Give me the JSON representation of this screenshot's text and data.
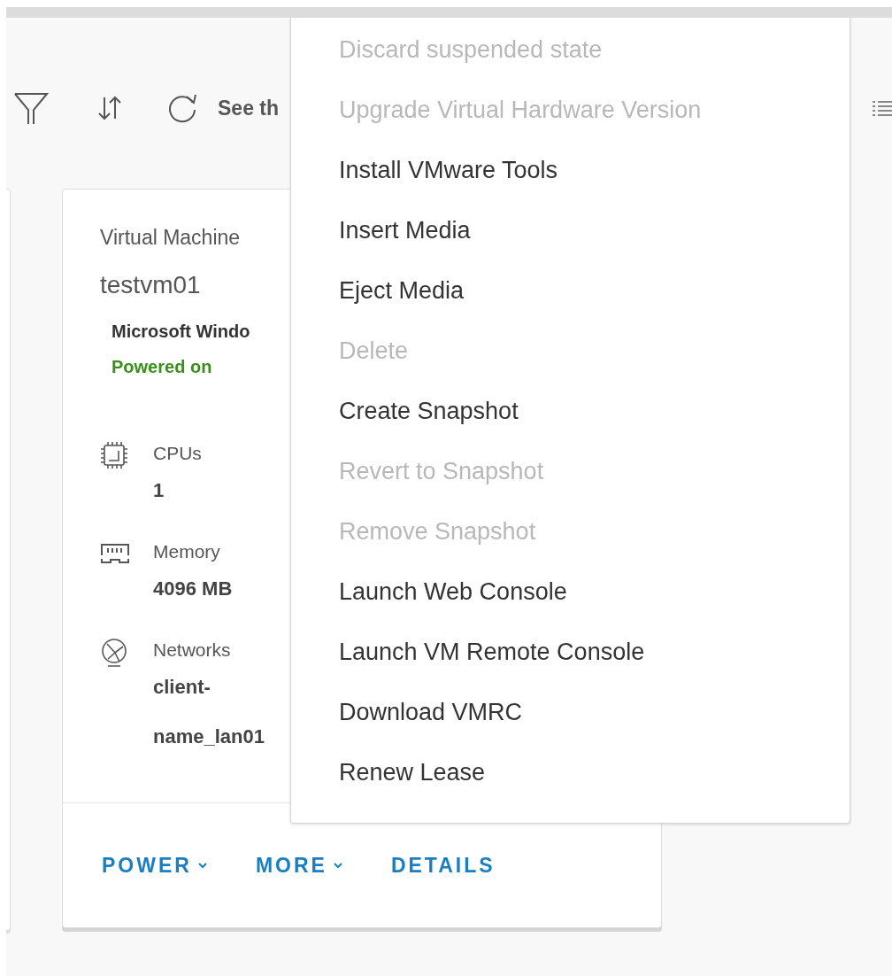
{
  "toolbar": {
    "link_text": "See th"
  },
  "card": {
    "type_label": "Virtual Machine",
    "name": "testvm01",
    "os": "Microsoft Windo",
    "status": "Powered on",
    "powered_on": true,
    "specs": [
      {
        "kind": "cpu",
        "label": "CPUs",
        "values": [
          "1"
        ]
      },
      {
        "kind": "memory",
        "label": "Memory",
        "values": [
          "4096 MB"
        ]
      },
      {
        "kind": "network",
        "label": "Networks",
        "values": [
          "client-",
          "name_lan01"
        ]
      }
    ],
    "actions": [
      {
        "label": "POWER",
        "dropdown": true
      },
      {
        "label": "MORE",
        "dropdown": true
      },
      {
        "label": "DETAILS",
        "dropdown": false
      }
    ]
  },
  "menu": {
    "items": [
      {
        "label": "Discard suspended state",
        "disabled": true
      },
      {
        "label": "Upgrade Virtual Hardware Version",
        "disabled": true
      },
      {
        "label": "Install VMware Tools",
        "disabled": false
      },
      {
        "label": "Insert Media",
        "disabled": false
      },
      {
        "label": "Eject Media",
        "disabled": false
      },
      {
        "label": "Delete",
        "disabled": true
      },
      {
        "label": "Create Snapshot",
        "disabled": false
      },
      {
        "label": "Revert to Snapshot",
        "disabled": true
      },
      {
        "label": "Remove Snapshot",
        "disabled": true
      },
      {
        "label": "Launch Web Console",
        "disabled": false
      },
      {
        "label": "Launch VM Remote Console",
        "disabled": false
      },
      {
        "label": "Download VMRC",
        "disabled": false
      },
      {
        "label": "Renew Lease",
        "disabled": false
      }
    ]
  }
}
